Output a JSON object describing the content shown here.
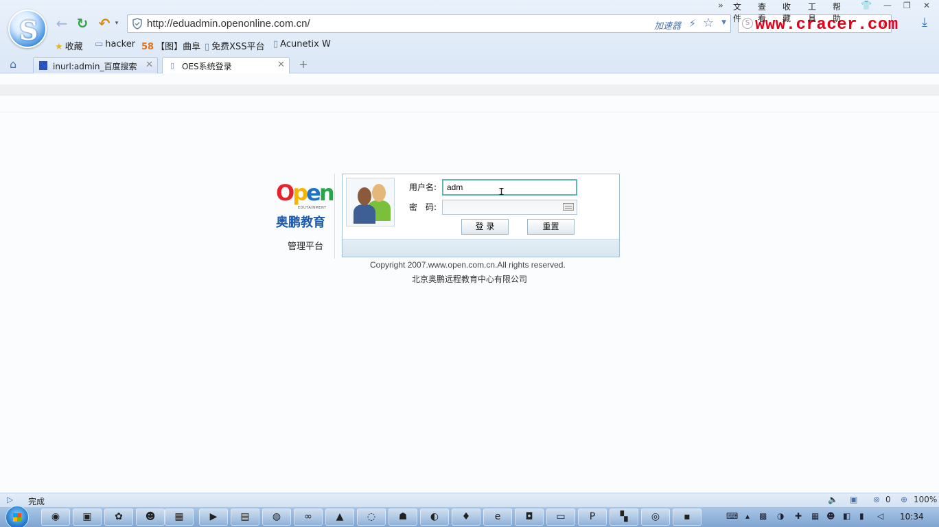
{
  "browser": {
    "url": "http://eduadmin.openonline.com.cn/",
    "accelerator_label": "加速器",
    "watermark": "www.cracer.com",
    "menu": {
      "more": "»",
      "file": "文件",
      "view": "查看",
      "favorites": "收藏",
      "tools": "工具",
      "help": "帮助"
    },
    "bookmarks": [
      {
        "icon": "star-icon",
        "label": "收藏"
      },
      {
        "icon": "folder-icon",
        "label": "hacker"
      },
      {
        "icon": "58-icon",
        "label": "【图】曲阜"
      },
      {
        "icon": "page-icon",
        "label": "免费XSS平台"
      },
      {
        "icon": "page-icon",
        "label": "Acunetix W"
      }
    ],
    "tabs": [
      {
        "icon": "baidu-icon",
        "title": "inurl:admin_百度搜索",
        "active": false
      },
      {
        "icon": "page-icon",
        "title": "OES系统登录",
        "active": true
      }
    ],
    "new_tab": "+"
  },
  "page": {
    "brand": {
      "word": {
        "o": "O",
        "p": "p",
        "e": "e",
        "n": "n"
      },
      "tagline": "EDUTAINMENT",
      "cn_name": "奥鹏教育",
      "subtitle": "管理平台"
    },
    "login": {
      "username_label": "用户名:",
      "password_label": "密　码:",
      "username_value": "adm",
      "password_value": "",
      "login_button": "登 录",
      "reset_button": "重置"
    },
    "copyright": "Copyright 2007.www.open.com.cn.All rights reserved.",
    "company": "北京奥鹏远程教育中心有限公司"
  },
  "statusbar": {
    "text": "完成",
    "count": "0",
    "zoom": "100%"
  },
  "taskbar": {
    "time": "10:34"
  }
}
